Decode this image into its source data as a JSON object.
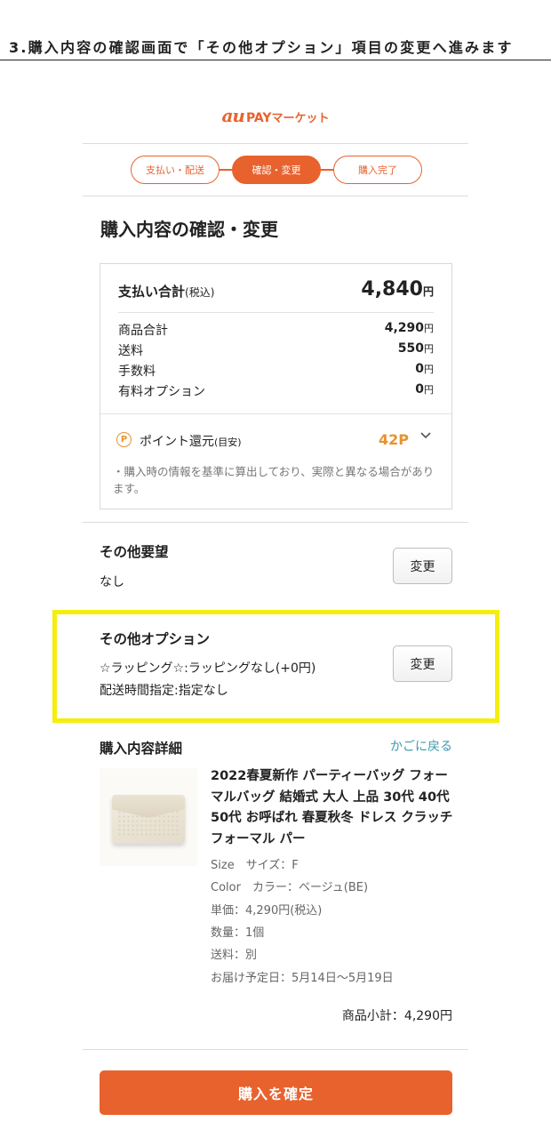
{
  "heading": "3.購入内容の確認画面で「その他オプション」項目の変更へ進みます",
  "logo": {
    "au": "au",
    "pay": "PAY",
    "market": "マーケット"
  },
  "steps": [
    "支払い・配送",
    "確認・変更",
    "購入完了"
  ],
  "page_title": "購入内容の確認・変更",
  "summary": {
    "total_label": "支払い合計",
    "total_tax": "(税込)",
    "total_value": "4,840",
    "yen": "円",
    "rows": [
      {
        "label": "商品合計",
        "value": "4,290"
      },
      {
        "label": "送料",
        "value": "550"
      },
      {
        "label": "手数料",
        "value": "0"
      },
      {
        "label": "有料オプション",
        "value": "0"
      }
    ],
    "points": {
      "icon_letter": "P",
      "label": "ポイント還元",
      "label_sub": "(目安)",
      "value": "42P",
      "note": "・購入時の情報を基準に算出しており、実際と異なる場合があります。"
    }
  },
  "other_requests": {
    "title": "その他要望",
    "value": "なし",
    "button": "変更"
  },
  "other_options": {
    "title": "その他オプション",
    "line1": "☆ラッピング☆:ラッピングなし(+0円)",
    "line2": "配送時間指定:指定なし",
    "button": "変更"
  },
  "details": {
    "title": "購入内容詳細",
    "back_link": "かごに戻る",
    "product_name": "2022春夏新作 パーティーバッグ フォーマルバッグ 結婚式 大人 上品 30代 40代 50代 お呼ばれ 春夏秋冬 ドレス クラッチ フォーマル パー",
    "attributes": [
      "Size　サイズ：F",
      "Color　カラー：ベージュ(BE)",
      "単価：4,290円(税込)",
      "数量：1個",
      "送料：別",
      "お届け予定日：5月14日〜5月19日"
    ],
    "subtotal": "商品小計：4,290円"
  },
  "confirm_button": "購入を確定",
  "colors": {
    "accent": "#e8622e",
    "point": "#e8922e",
    "link": "#3b9ab0",
    "highlight": "#f5ee0c"
  },
  "icons": {
    "points": "point-circle-icon",
    "expand": "chevron-down-icon"
  }
}
